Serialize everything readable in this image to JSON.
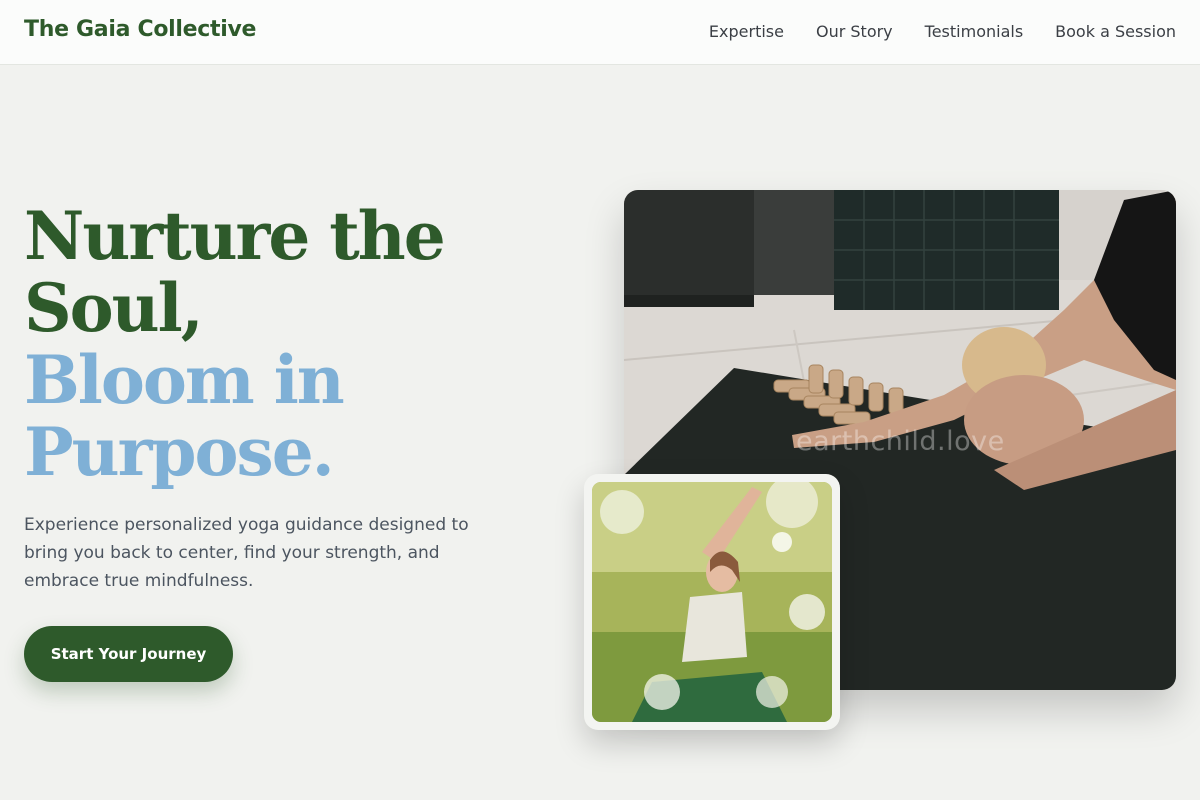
{
  "header": {
    "brand": "The Gaia Collective",
    "nav": [
      "Expertise",
      "Our Story",
      "Testimonials",
      "Book a Session"
    ]
  },
  "hero": {
    "title_line1": "Nurture the",
    "title_line2": "Soul,",
    "title_line3": "Bloom in",
    "title_line4": "Purpose.",
    "description": "Experience personalized yoga guidance designed to bring you back to center, find your strength, and embrace true mindfulness.",
    "cta_label": "Start Your Journey"
  },
  "images": {
    "main_watermark": "earthchild.love"
  },
  "colors": {
    "brand_green": "#2e5a2b",
    "accent_blue": "#7fb0d6",
    "background": "#f1f2ef"
  }
}
